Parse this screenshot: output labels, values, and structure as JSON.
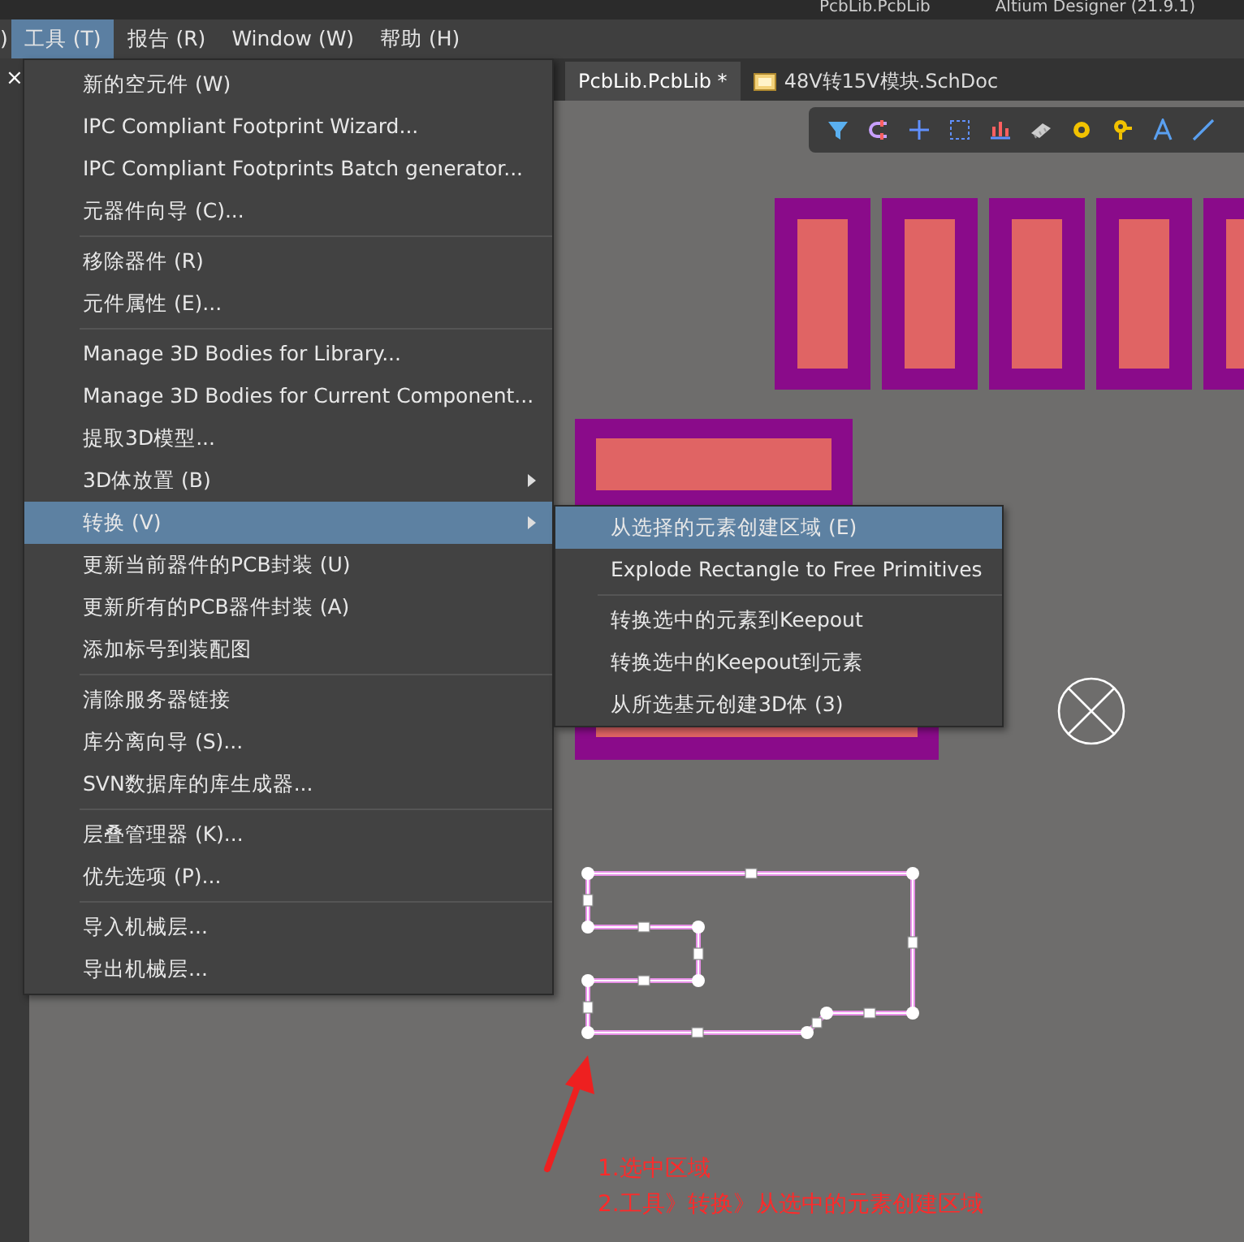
{
  "title_bar": {
    "document": "PcbLib.PcbLib",
    "app": "Altium Designer (21.9.1)"
  },
  "menu_bar": [
    {
      "label": ")",
      "selected": false
    },
    {
      "label": "工具 (T)",
      "selected": true
    },
    {
      "label": "报告 (R)",
      "selected": false
    },
    {
      "label": "Window (W)",
      "selected": false
    },
    {
      "label": "帮助 (H)",
      "selected": false
    }
  ],
  "side_panel": {
    "close": "×"
  },
  "tabs": [
    {
      "label": "PcbLib.PcbLib *",
      "selected": true,
      "kind": "pcb"
    },
    {
      "label": "48V转15V模块.SchDoc",
      "selected": false,
      "kind": "sch"
    }
  ],
  "tools_menu": [
    [
      {
        "label": "新的空元件 (W)",
        "submenu": false,
        "selected": false
      },
      {
        "label": "IPC Compliant Footprint Wizard...",
        "submenu": false,
        "selected": false
      },
      {
        "label": "IPC Compliant Footprints Batch generator...",
        "submenu": false,
        "selected": false
      },
      {
        "label": "元器件向导 (C)...",
        "submenu": false,
        "selected": false
      }
    ],
    [
      {
        "label": "移除器件 (R)",
        "submenu": false,
        "selected": false
      },
      {
        "label": "元件属性 (E)...",
        "submenu": false,
        "selected": false
      }
    ],
    [
      {
        "label": "Manage 3D Bodies for Library...",
        "submenu": false,
        "selected": false
      },
      {
        "label": "Manage 3D Bodies for Current Component...",
        "submenu": false,
        "selected": false
      },
      {
        "label": "提取3D模型...",
        "submenu": false,
        "selected": false
      },
      {
        "label": "3D体放置 (B)",
        "submenu": true,
        "selected": false
      },
      {
        "label": "转换 (V)",
        "submenu": true,
        "selected": true
      },
      {
        "label": "更新当前器件的PCB封装 (U)",
        "submenu": false,
        "selected": false
      },
      {
        "label": "更新所有的PCB器件封装 (A)",
        "submenu": false,
        "selected": false
      },
      {
        "label": "添加标号到装配图",
        "submenu": false,
        "selected": false
      }
    ],
    [
      {
        "label": "清除服务器链接",
        "submenu": false,
        "selected": false
      },
      {
        "label": "库分离向导 (S)...",
        "submenu": false,
        "selected": false
      },
      {
        "label": "SVN数据库的库生成器...",
        "submenu": false,
        "selected": false
      }
    ],
    [
      {
        "label": "层叠管理器 (K)...",
        "submenu": false,
        "selected": false
      },
      {
        "label": "优先选项 (P)...",
        "submenu": false,
        "selected": false
      }
    ],
    [
      {
        "label": "导入机械层...",
        "submenu": false,
        "selected": false
      },
      {
        "label": "导出机械层...",
        "submenu": false,
        "selected": false
      }
    ]
  ],
  "convert_submenu": [
    [
      {
        "label": "从选择的元素创建区域 (E)",
        "selected": true
      },
      {
        "label": "Explode Rectangle to Free Primitives",
        "selected": false
      }
    ],
    [
      {
        "label": "转换选中的元素到Keepout",
        "selected": false
      },
      {
        "label": "转换选中的Keepout到元素",
        "selected": false
      },
      {
        "label": "从所选基元创建3D体 (3)",
        "selected": false
      }
    ]
  ],
  "annotations": [
    "1.选中区域",
    "2.工具》转换》从选中的元素创建区域"
  ]
}
